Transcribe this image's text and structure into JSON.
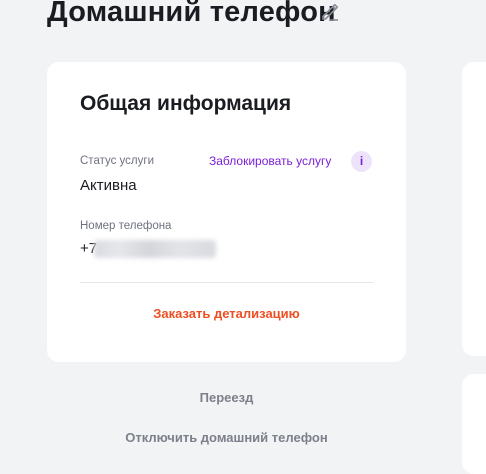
{
  "header": {
    "title": "Домашний телефон",
    "edit_icon": "pencil-icon"
  },
  "info_card": {
    "title": "Общая информация",
    "status_label": "Статус услуги",
    "status_value": "Активна",
    "block_link": "Заблокировать услугу",
    "info_button": "i",
    "phone_label": "Номер телефона",
    "phone_prefix": "+7",
    "detail_link": "Заказать детализацию"
  },
  "actions": {
    "move": "Переезд",
    "disable": "Отключить домашний телефон"
  },
  "colors": {
    "accent_purple": "#7b1fd9",
    "accent_orange": "#ef4e23",
    "background": "#f2f3f5"
  }
}
